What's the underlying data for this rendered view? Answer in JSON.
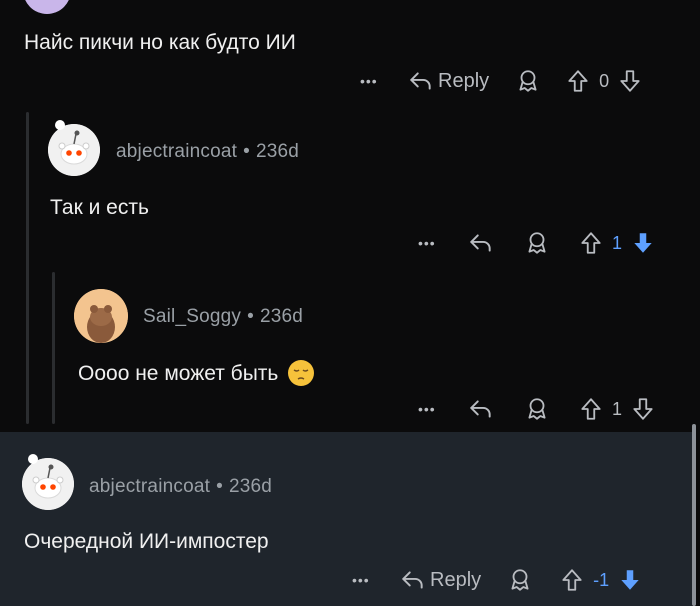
{
  "top_comment": {
    "text": "Найс пикчи но как будто ИИ",
    "actions": {
      "more": "•••",
      "reply": "Reply",
      "score": "0"
    }
  },
  "reply1": {
    "user": "abjectraincoat",
    "age": "236d",
    "sep": "•",
    "text": "Так и есть",
    "actions": {
      "more": "•••",
      "score": "1"
    }
  },
  "reply2": {
    "user": "Sail_Soggy",
    "age": "236d",
    "sep": "•",
    "text": "Оооо не может быть",
    "emoji": "😔",
    "actions": {
      "more": "•••",
      "score": "1"
    }
  },
  "reply3": {
    "user": "abjectraincoat",
    "age": "236d",
    "sep": "•",
    "text": "Очередной ИИ-импостер",
    "actions": {
      "more": "•••",
      "reply": "Reply",
      "score": "-1"
    }
  },
  "colors": {
    "background": "#0b0b0c",
    "highlight": "#1f252c",
    "upvote_active": "#5ea0ff",
    "downvote_active": "#5ea0ff",
    "text_muted": "#9aa0a6"
  }
}
